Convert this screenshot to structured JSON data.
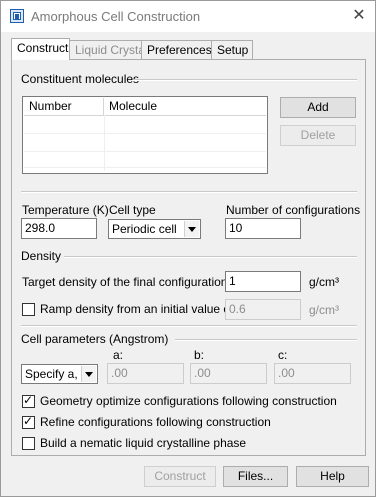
{
  "window": {
    "title": "Amorphous Cell Construction",
    "close_glyph": "✕"
  },
  "tabs": [
    {
      "label": "Construct",
      "active": true
    },
    {
      "label": "Liquid Crystal",
      "disabled": true
    },
    {
      "label": "Preferences"
    },
    {
      "label": "Setup"
    }
  ],
  "constituents": {
    "section_label": "Constituent molecules",
    "columns": [
      "Number",
      "Molecule"
    ],
    "add_label": "Add",
    "delete_label": "Delete"
  },
  "params": {
    "temperature_label": "Temperature (K)",
    "temperature_value": "298.0",
    "cell_type_label": "Cell type",
    "cell_type_value": "Periodic cell",
    "num_configs_label": "Number of configurations",
    "num_configs_value": "10"
  },
  "density": {
    "section_label": "Density",
    "target_label": "Target density of the final configurations:",
    "target_value": "1",
    "target_unit": "g/cm³",
    "ramp_label": "Ramp density from an initial value of:",
    "ramp_checked": false,
    "ramp_value": "0.6",
    "ramp_unit": "g/cm³"
  },
  "cell_params": {
    "section_label": "Cell parameters (Angstrom)",
    "mode_value": "Specify a, b",
    "a_label": "a:",
    "b_label": "b:",
    "c_label": "c:",
    "a_value": ".00",
    "b_value": ".00",
    "c_value": ".00"
  },
  "options": {
    "geometry_label": "Geometry optimize configurations following construction",
    "geometry_checked": true,
    "refine_label": "Refine configurations following construction",
    "refine_checked": true,
    "nematic_label": "Build a nematic liquid crystalline phase",
    "nematic_checked": false
  },
  "footer": {
    "construct_label": "Construct",
    "files_label": "Files...",
    "help_label": "Help"
  }
}
